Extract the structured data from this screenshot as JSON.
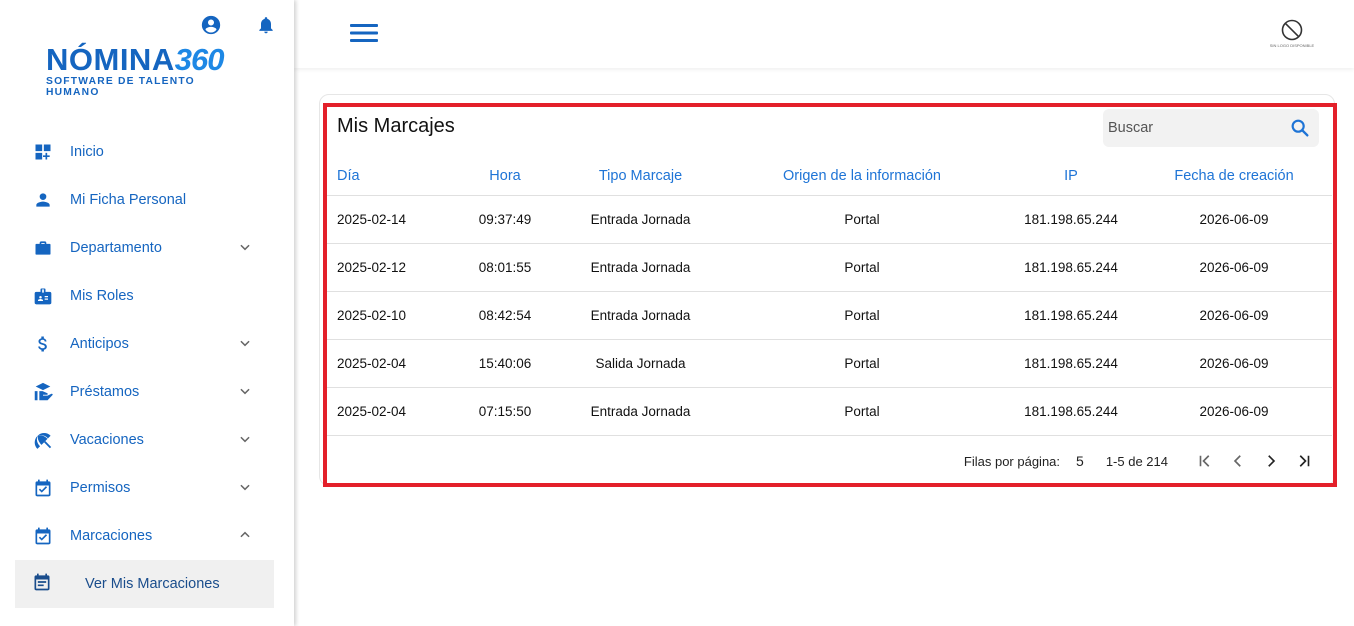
{
  "brand": {
    "name_text": "NÓMINA",
    "name_number": "360",
    "tagline": "SOFTWARE DE TALENTO HUMANO",
    "color": "#1565c0"
  },
  "header": {
    "icons": [
      "account-circle-icon",
      "bell-icon",
      "menu-icon"
    ],
    "profile_caption": "SIN LOGO DISPONIBLE"
  },
  "sidebar": {
    "items": [
      {
        "label": "Inicio",
        "icon": "dashboard-add-icon",
        "expandable": false
      },
      {
        "label": "Mi Ficha Personal",
        "icon": "person-icon",
        "expandable": false
      },
      {
        "label": "Departamento",
        "icon": "briefcase-icon",
        "expandable": true,
        "expanded": false
      },
      {
        "label": "Mis Roles",
        "icon": "badge-icon",
        "expandable": false
      },
      {
        "label": "Anticipos",
        "icon": "dollar-icon",
        "expandable": true,
        "expanded": false
      },
      {
        "label": "Préstamos",
        "icon": "hand-money-icon",
        "expandable": true,
        "expanded": false
      },
      {
        "label": "Vacaciones",
        "icon": "beach-umbrella-icon",
        "expandable": true,
        "expanded": false
      },
      {
        "label": "Permisos",
        "icon": "calendar-check-icon",
        "expandable": true,
        "expanded": false
      },
      {
        "label": "Marcaciones",
        "icon": "calendar-check-icon",
        "expandable": true,
        "expanded": true
      }
    ],
    "subitem": {
      "label": "Ver Mis Marcaciones",
      "icon": "calendar-list-icon",
      "selected": true
    }
  },
  "main": {
    "title": "Mis Marcajes",
    "search": {
      "placeholder": "Buscar",
      "value": ""
    },
    "columns": [
      "Día",
      "Hora",
      "Tipo Marcaje",
      "Origen de la información",
      "IP",
      "Fecha de creación"
    ],
    "rows": [
      [
        "2025-02-14",
        "09:37:49",
        "Entrada Jornada",
        "Portal",
        "181.198.65.244",
        "2026-06-09"
      ],
      [
        "2025-02-12",
        "08:01:55",
        "Entrada Jornada",
        "Portal",
        "181.198.65.244",
        "2026-06-09"
      ],
      [
        "2025-02-10",
        "08:42:54",
        "Entrada Jornada",
        "Portal",
        "181.198.65.244",
        "2026-06-09"
      ],
      [
        "2025-02-04",
        "15:40:06",
        "Salida Jornada",
        "Portal",
        "181.198.65.244",
        "2026-06-09"
      ],
      [
        "2025-02-04",
        "07:15:50",
        "Entrada Jornada",
        "Portal",
        "181.198.65.244",
        "2026-06-09"
      ]
    ],
    "pagination": {
      "rows_per_page_label": "Filas por página:",
      "rows_per_page": "5",
      "range": "1-5 de 214"
    }
  },
  "colors": {
    "accent": "#1e74d6",
    "highlight_border": "#e3202a",
    "selected_bg": "#f0f0f0"
  }
}
